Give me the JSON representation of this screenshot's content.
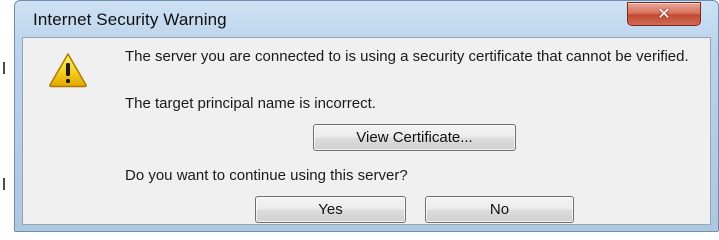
{
  "window": {
    "title": "Internet Security Warning",
    "close_glyph": "✕",
    "accent": "#b4cde6",
    "close_color": "#c14a33"
  },
  "icons": {
    "warning": "warning-icon",
    "close": "close-icon"
  },
  "message": {
    "line1": "The server you are connected to is using a security certificate that cannot be verified.",
    "line2": "The target principal name is incorrect.",
    "question": "Do you want to continue using this server?"
  },
  "buttons": {
    "view_certificate": "View Certificate...",
    "yes": "Yes",
    "no": "No"
  }
}
